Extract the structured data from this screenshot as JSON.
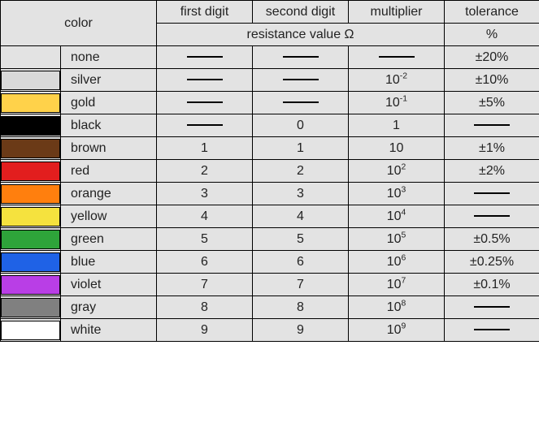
{
  "headers": {
    "color": "color",
    "first_digit": "first digit",
    "second_digit": "second digit",
    "multiplier": "multiplier",
    "tolerance": "tolerance",
    "resistance_value": "resistance value   Ω",
    "percent": "%"
  },
  "rows": [
    {
      "swatch": null,
      "name": "none",
      "d1": null,
      "d2": null,
      "mult": null,
      "mult_exp": null,
      "tol": "±20%"
    },
    {
      "swatch": "#d9d9d9",
      "name": "silver",
      "d1": null,
      "d2": null,
      "mult": "10",
      "mult_exp": "-2",
      "tol": "±10%"
    },
    {
      "swatch": "#ffd24a",
      "name": "gold",
      "d1": null,
      "d2": null,
      "mult": "10",
      "mult_exp": "-1",
      "tol": "±5%"
    },
    {
      "swatch": "#000000",
      "name": "black",
      "d1": null,
      "d2": "0",
      "mult": "1",
      "mult_exp": null,
      "tol": null
    },
    {
      "swatch": "#6b3a17",
      "name": "brown",
      "d1": "1",
      "d2": "1",
      "mult": "10",
      "mult_exp": null,
      "tol": "±1%"
    },
    {
      "swatch": "#e21e1e",
      "name": "red",
      "d1": "2",
      "d2": "2",
      "mult": "10",
      "mult_exp": "2",
      "tol": "±2%"
    },
    {
      "swatch": "#ff7f0e",
      "name": "orange",
      "d1": "3",
      "d2": "3",
      "mult": "10",
      "mult_exp": "3",
      "tol": null
    },
    {
      "swatch": "#f5e23e",
      "name": "yellow",
      "d1": "4",
      "d2": "4",
      "mult": "10",
      "mult_exp": "4",
      "tol": null
    },
    {
      "swatch": "#2ea43a",
      "name": "green",
      "d1": "5",
      "d2": "5",
      "mult": "10",
      "mult_exp": "5",
      "tol": "±0.5%"
    },
    {
      "swatch": "#1f62e6",
      "name": "blue",
      "d1": "6",
      "d2": "6",
      "mult": "10",
      "mult_exp": "6",
      "tol": "±0.25%"
    },
    {
      "swatch": "#b93ee6",
      "name": "violet",
      "d1": "7",
      "d2": "7",
      "mult": "10",
      "mult_exp": "7",
      "tol": "±0.1%"
    },
    {
      "swatch": "#808080",
      "name": "gray",
      "d1": "8",
      "d2": "8",
      "mult": "10",
      "mult_exp": "8",
      "tol": null
    },
    {
      "swatch": "#ffffff",
      "name": "white",
      "d1": "9",
      "d2": "9",
      "mult": "10",
      "mult_exp": "9",
      "tol": null
    }
  ],
  "chart_data": {
    "type": "table",
    "title": "Resistor color code",
    "columns": [
      "color",
      "first digit",
      "second digit",
      "multiplier",
      "tolerance"
    ],
    "data": [
      {
        "color": "none",
        "first_digit": null,
        "second_digit": null,
        "multiplier": null,
        "tolerance_pct": 20
      },
      {
        "color": "silver",
        "first_digit": null,
        "second_digit": null,
        "multiplier": 0.01,
        "tolerance_pct": 10
      },
      {
        "color": "gold",
        "first_digit": null,
        "second_digit": null,
        "multiplier": 0.1,
        "tolerance_pct": 5
      },
      {
        "color": "black",
        "first_digit": null,
        "second_digit": 0,
        "multiplier": 1,
        "tolerance_pct": null
      },
      {
        "color": "brown",
        "first_digit": 1,
        "second_digit": 1,
        "multiplier": 10,
        "tolerance_pct": 1
      },
      {
        "color": "red",
        "first_digit": 2,
        "second_digit": 2,
        "multiplier": 100,
        "tolerance_pct": 2
      },
      {
        "color": "orange",
        "first_digit": 3,
        "second_digit": 3,
        "multiplier": 1000,
        "tolerance_pct": null
      },
      {
        "color": "yellow",
        "first_digit": 4,
        "second_digit": 4,
        "multiplier": 10000,
        "tolerance_pct": null
      },
      {
        "color": "green",
        "first_digit": 5,
        "second_digit": 5,
        "multiplier": 100000,
        "tolerance_pct": 0.5
      },
      {
        "color": "blue",
        "first_digit": 6,
        "second_digit": 6,
        "multiplier": 1000000,
        "tolerance_pct": 0.25
      },
      {
        "color": "violet",
        "first_digit": 7,
        "second_digit": 7,
        "multiplier": 10000000,
        "tolerance_pct": 0.1
      },
      {
        "color": "gray",
        "first_digit": 8,
        "second_digit": 8,
        "multiplier": 100000000,
        "tolerance_pct": null
      },
      {
        "color": "white",
        "first_digit": 9,
        "second_digit": 9,
        "multiplier": 1000000000,
        "tolerance_pct": null
      }
    ]
  }
}
